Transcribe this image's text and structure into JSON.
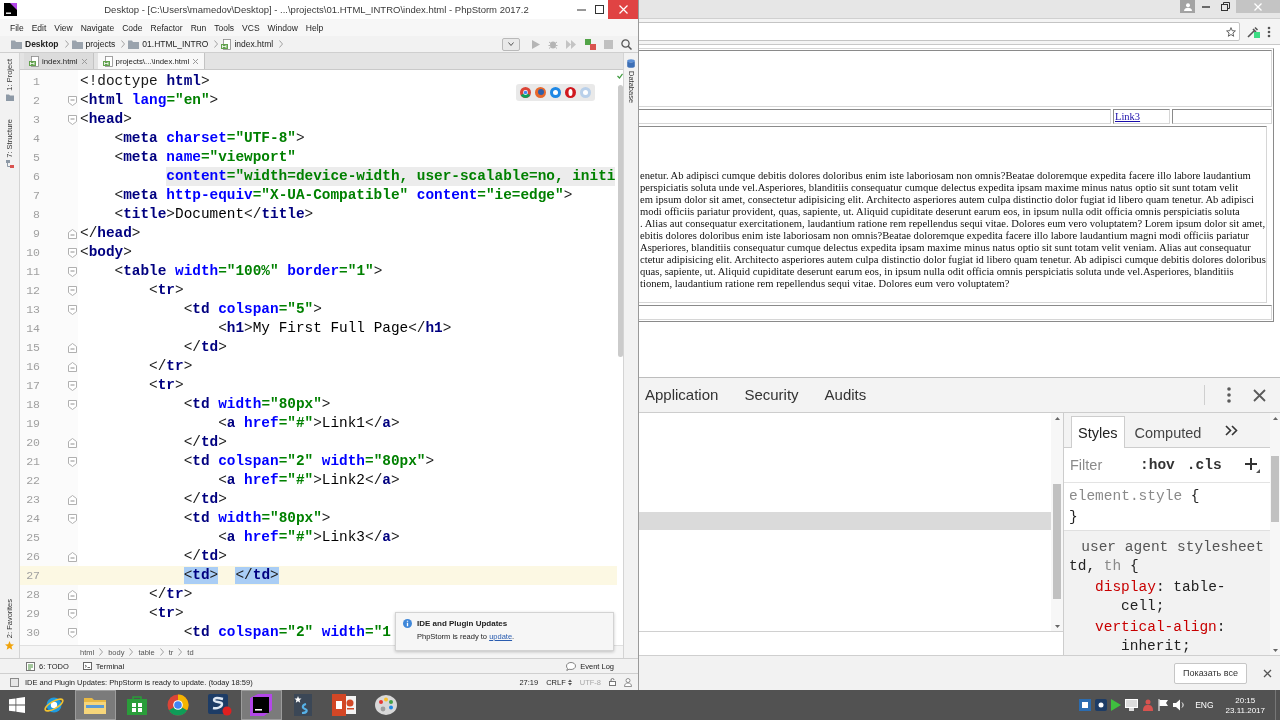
{
  "ide": {
    "title": "Desktop - [C:\\Users\\mamedov\\Desktop] - ...\\projects\\01.HTML_INTRO\\index.html - PhpStorm 2017.2",
    "menu": [
      "File",
      "Edit",
      "View",
      "Navigate",
      "Code",
      "Refactor",
      "Run",
      "Tools",
      "VCS",
      "Window",
      "Help"
    ],
    "breadcrumbs": [
      {
        "label": "Desktop",
        "kind": "project"
      },
      {
        "label": "projects",
        "kind": "folder"
      },
      {
        "label": "01.HTML_INTRO",
        "kind": "folder"
      },
      {
        "label": "index.html",
        "kind": "file"
      }
    ],
    "tabs": [
      {
        "label": "index.html",
        "selected": false
      },
      {
        "label": "projects\\...\\index.html",
        "selected": true
      }
    ],
    "left_top_tools": [
      {
        "label": "1: Project",
        "kind": "project"
      },
      {
        "label": "7: Structure",
        "kind": "structure"
      }
    ],
    "left_bottom_tools": [
      {
        "label": "2: Favorites",
        "kind": "favorites"
      }
    ],
    "right_tools": [
      {
        "label": "Database",
        "kind": "database"
      }
    ],
    "lines": [
      {
        "number": "1",
        "code": "<!doctype html>",
        "kind": "plain",
        "current": false,
        "shaded": false
      },
      {
        "number": "2",
        "code": "<html lang=\"en\">",
        "kind": "fold-start",
        "current": false,
        "shaded": false
      },
      {
        "number": "3",
        "code": "<head>",
        "kind": "fold-start",
        "current": false,
        "shaded": false
      },
      {
        "number": "4",
        "code": "    <meta charset=\"UTF-8\">",
        "kind": "plain",
        "current": false,
        "shaded": false
      },
      {
        "number": "5",
        "code": "    <meta name=\"viewport\"",
        "kind": "plain",
        "current": false,
        "shaded": false
      },
      {
        "number": "6",
        "code": "          content=\"width=device-width, user-scalable=no, initi",
        "kind": "plain",
        "current": false,
        "shaded": true
      },
      {
        "number": "7",
        "code": "    <meta http-equiv=\"X-UA-Compatible\" content=\"ie=edge\">",
        "kind": "plain",
        "current": false,
        "shaded": false
      },
      {
        "number": "8",
        "code": "    <title>Document</title>",
        "kind": "plain",
        "current": false,
        "shaded": false
      },
      {
        "number": "9",
        "code": "</head>",
        "kind": "fold-end",
        "current": false,
        "shaded": false
      },
      {
        "number": "10",
        "code": "<body>",
        "kind": "fold-start",
        "current": false,
        "shaded": false
      },
      {
        "number": "11",
        "code": "    <table width=\"100%\" border=\"1\">",
        "kind": "fold-start",
        "current": false,
        "shaded": false
      },
      {
        "number": "12",
        "code": "        <tr>",
        "kind": "fold-start",
        "current": false,
        "shaded": false
      },
      {
        "number": "13",
        "code": "            <td colspan=\"5\">",
        "kind": "fold-start",
        "current": false,
        "shaded": false
      },
      {
        "number": "14",
        "code": "                <h1>My First Full Page</h1>",
        "kind": "plain",
        "current": false,
        "shaded": false
      },
      {
        "number": "15",
        "code": "            </td>",
        "kind": "fold-end",
        "current": false,
        "shaded": false
      },
      {
        "number": "16",
        "code": "        </tr>",
        "kind": "fold-end",
        "current": false,
        "shaded": false
      },
      {
        "number": "17",
        "code": "        <tr>",
        "kind": "fold-start",
        "current": false,
        "shaded": false
      },
      {
        "number": "18",
        "code": "            <td width=\"80px\">",
        "kind": "fold-start",
        "current": false,
        "shaded": false
      },
      {
        "number": "19",
        "code": "                <a href=\"#\">Link1</a>",
        "kind": "plain",
        "current": false,
        "shaded": false
      },
      {
        "number": "20",
        "code": "            </td>",
        "kind": "fold-end",
        "current": false,
        "shaded": false
      },
      {
        "number": "21",
        "code": "            <td colspan=\"2\" width=\"80px\">",
        "kind": "fold-start",
        "current": false,
        "shaded": false
      },
      {
        "number": "22",
        "code": "                <a href=\"#\">Link2</a>",
        "kind": "plain",
        "current": false,
        "shaded": false
      },
      {
        "number": "23",
        "code": "            </td>",
        "kind": "fold-end",
        "current": false,
        "shaded": false
      },
      {
        "number": "24",
        "code": "            <td width=\"80px\">",
        "kind": "fold-start",
        "current": false,
        "shaded": false
      },
      {
        "number": "25",
        "code": "                <a href=\"#\">Link3</a>",
        "kind": "plain",
        "current": false,
        "shaded": false
      },
      {
        "number": "26",
        "code": "            </td>",
        "kind": "fold-end",
        "current": false,
        "shaded": false
      },
      {
        "number": "27",
        "code": "            <td>  </td>",
        "kind": "plain",
        "current": true,
        "shaded": false
      },
      {
        "number": "28",
        "code": "        </tr>",
        "kind": "fold-end",
        "current": false,
        "shaded": false
      },
      {
        "number": "29",
        "code": "        <tr>",
        "kind": "fold-start",
        "current": false,
        "shaded": false
      },
      {
        "number": "30",
        "code": "            <td colspan=\"2\" width=\"1",
        "kind": "fold-start",
        "current": false,
        "shaded": false
      }
    ],
    "tag_path": [
      "html",
      "body",
      "table",
      "tr",
      "td"
    ],
    "bottom_tools": [
      {
        "label": "6: TODO",
        "kind": "todo"
      },
      {
        "label": "Terminal",
        "kind": "terminal"
      }
    ],
    "event_log": "Event Log",
    "notification": {
      "title": "IDE and Plugin Updates",
      "text_before": "PhpStorm is ready to ",
      "link": "update",
      "text_after": "."
    },
    "status": {
      "message": "IDE and Plugin Updates: PhpStorm is ready to update. (today 18:59)",
      "caret": "27:19",
      "line_separator": "CRLF",
      "encoding": {
        "label": "UTF-8",
        "disabled": true
      }
    }
  },
  "browser": {
    "link": "Link3",
    "paragraph_lines": [
      "enetur. Ab adipisci cumque debitis dolores doloribus enim iste laboriosam non omnis?Beatae doloremque expedita facere illo labore laudantium",
      "perspiciatis soluta unde vel.Asperiores, blanditiis consequatur cumque delectus expedita ipsam maxime minus natus optio sit sunt totam velit",
      "em ipsum dolor sit amet, consectetur adipisicing elit. Architecto asperiores autem culpa distinctio dolor fugiat id libero quam tenetur. Ab adipisci",
      "modi officiis pariatur provident, quas, sapiente, ut. Aliquid cupiditate deserunt earum eos, in ipsum nulla odit officia omnis perspiciatis soluta",
      ". Alias aut consequatur exercitationem, laudantium ratione rem repellendus sequi vitae. Dolores eum vero voluptatem? Lorem ipsum dolor sit amet,",
      "ebitis dolores doloribus enim iste laboriosam non omnis?Beatae doloremque expedita facere illo labore laudantium magni modi officiis pariatur",
      "Asperiores, blanditiis consequatur cumque delectus expedita ipsam maxime minus natus optio sit sunt totam velit veniam. Alias aut consequatur",
      "ctetur adipisicing elit. Architecto asperiores autem culpa distinctio dolor fugiat id libero quam tenetur. Ab adipisci cumque debitis dolores doloribus",
      "quas, sapiente, ut. Aliquid cupiditate deserunt earum eos, in ipsum nulla odit officia omnis perspiciatis soluta unde vel.Asperiores, blanditiis",
      "tionem, laudantium ratione rem repellendus sequi vitae. Dolores eum vero voluptatem?"
    ]
  },
  "devtools": {
    "tabs": [
      {
        "label": "Application",
        "selected": false
      },
      {
        "label": "Security",
        "selected": false
      },
      {
        "label": "Audits",
        "selected": false
      }
    ],
    "sidebar_tabs": [
      {
        "label": "Styles",
        "selected": true
      },
      {
        "label": "Computed",
        "selected": false
      }
    ],
    "filter": {
      "placeholder": "Filter"
    },
    "toggles": [
      ":hov",
      ".cls"
    ],
    "rules": [
      {
        "kind": "inline",
        "selector": [
          {
            "text": "element.style",
            "dimmed": true
          },
          {
            "text": " {",
            "dimmed": false
          }
        ],
        "close": "}"
      },
      {
        "kind": "user-agent",
        "origin": "user agent stylesheet",
        "selector": [
          {
            "text": "td, ",
            "dimmed": false
          },
          {
            "text": "th",
            "dimmed": true
          },
          {
            "text": " {",
            "dimmed": false
          }
        ],
        "declarations": [
          "display: table-cell;",
          "vertical-align: inherit;"
        ]
      }
    ]
  },
  "downloads_bar": {
    "button": "Показать все"
  },
  "taskbar": {
    "apps": [
      {
        "kind": "globe",
        "highlighted": false
      },
      {
        "kind": "folder",
        "highlighted": true
      },
      {
        "kind": "bag",
        "highlighted": false
      },
      {
        "kind": "ball",
        "highlighted": false
      },
      {
        "kind": "dot-tile",
        "highlighted": false
      },
      {
        "kind": "ide-tile",
        "highlighted": true
      },
      {
        "kind": "star-tile",
        "highlighted": false
      },
      {
        "kind": "slides",
        "highlighted": false
      },
      {
        "kind": "palette",
        "highlighted": false
      }
    ],
    "language": "ENG",
    "time": "20:15",
    "date": "23.11.2017"
  }
}
